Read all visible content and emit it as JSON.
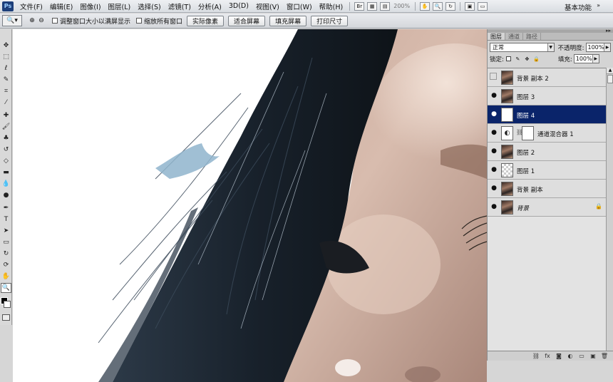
{
  "app": {
    "logo": "Ps"
  },
  "menu": {
    "items": [
      "文件(F)",
      "编辑(E)",
      "图像(I)",
      "图层(L)",
      "选择(S)",
      "滤镜(T)",
      "分析(A)",
      "3D(D)",
      "视图(V)",
      "窗口(W)",
      "帮助(H)"
    ],
    "zoom": "200%",
    "workspace": "基本功能"
  },
  "options": {
    "checkbox_resize": "调整窗口大小以满屏显示",
    "checkbox_all_windows": "缩放所有窗口",
    "btn_actual_pixels": "实际像素",
    "btn_fit_screen": "适合屏幕",
    "btn_fill_screen": "填充屏幕",
    "btn_print_size": "打印尺寸"
  },
  "layers_panel": {
    "tabs": [
      "图层",
      "通道",
      "路径"
    ],
    "blend_mode": "正常",
    "opacity_label": "不透明度:",
    "opacity_value": "100%",
    "lock_label": "锁定:",
    "fill_label": "填充:",
    "fill_value": "100%",
    "layers": [
      {
        "name": "背景 副本 2",
        "visible": false,
        "thumb": "photo"
      },
      {
        "name": "图层 3",
        "visible": true,
        "thumb": "photo"
      },
      {
        "name": "图层 4",
        "visible": true,
        "thumb": "white",
        "selected": true
      },
      {
        "name": "通道混合器 1",
        "visible": true,
        "thumb": "adjustment",
        "mask": true
      },
      {
        "name": "图层 2",
        "visible": true,
        "thumb": "photo"
      },
      {
        "name": "图层 1",
        "visible": true,
        "thumb": "transparent"
      },
      {
        "name": "背景 副本",
        "visible": true,
        "thumb": "photo"
      },
      {
        "name": "背景",
        "visible": true,
        "thumb": "photo",
        "locked": true
      }
    ]
  },
  "colors": {
    "selection": "#0a246a",
    "foreground": "#000000",
    "background": "#ffffff"
  }
}
